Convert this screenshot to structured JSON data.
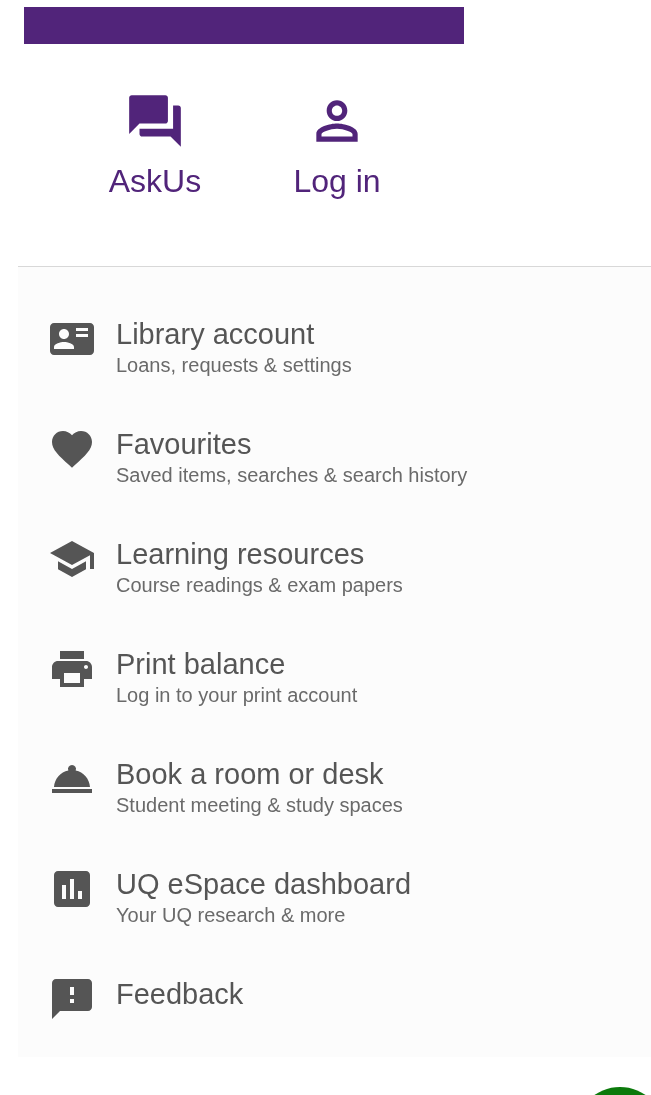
{
  "header_actions": [
    {
      "label": "AskUs"
    },
    {
      "label": "Log in"
    }
  ],
  "menu": {
    "items": [
      {
        "title": "Library account",
        "subtitle": "Loans, requests & settings"
      },
      {
        "title": "Favourites",
        "subtitle": "Saved items, searches & search history"
      },
      {
        "title": "Learning resources",
        "subtitle": "Course readings & exam papers"
      },
      {
        "title": "Print balance",
        "subtitle": "Log in to your print account"
      },
      {
        "title": "Book a room or desk",
        "subtitle": "Student meeting & study spaces"
      },
      {
        "title": "UQ eSpace dashboard",
        "subtitle": "Your UQ research & more"
      },
      {
        "title": "Feedback"
      }
    ]
  }
}
